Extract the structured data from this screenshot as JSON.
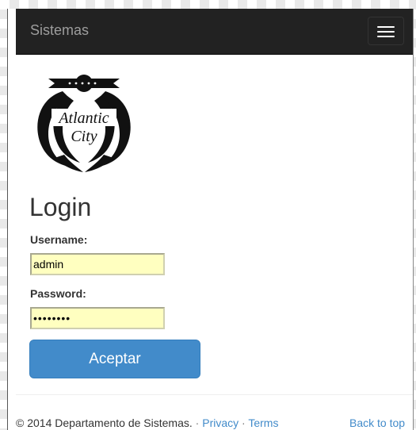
{
  "navbar": {
    "brand": "Sistemas"
  },
  "logo": {
    "line1": "Atlantic",
    "line2": "City"
  },
  "login": {
    "heading": "Login",
    "username_label": "Username:",
    "username_value": "admin",
    "password_label": "Password:",
    "password_value": "••••••••",
    "submit_label": "Aceptar"
  },
  "footer": {
    "copyright": "© 2014 Departamento de Sistemas.",
    "sep1": " · ",
    "privacy": "Privacy",
    "sep2": " · ",
    "terms": "Terms",
    "back_to_top": "Back to top"
  },
  "colors": {
    "navbar": "#222222",
    "primary": "#428bca",
    "autofill": "#ffffc0"
  }
}
